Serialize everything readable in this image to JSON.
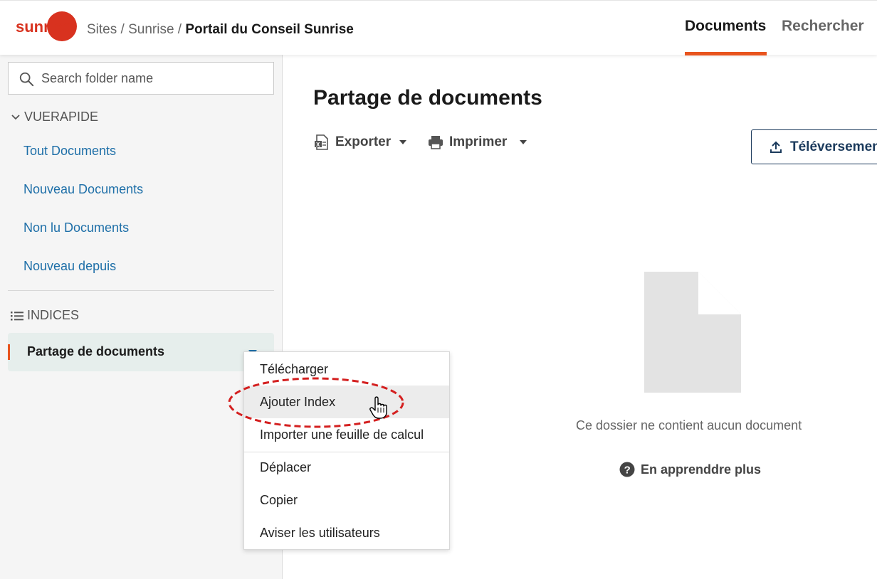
{
  "header": {
    "logo_text": "sunrise",
    "breadcrumb": {
      "items": [
        "Sites",
        "Sunrise"
      ],
      "separator": "/",
      "current": "Portail du Conseil Sunrise"
    },
    "tabs": [
      {
        "label": "Documents",
        "active": true
      },
      {
        "label": "Rechercher",
        "active": false
      }
    ]
  },
  "sidebar": {
    "search": {
      "placeholder": "Search folder name",
      "value": ""
    },
    "quick_view": {
      "title": "VUERAPIDE",
      "links": [
        "Tout Documents",
        "Nouveau Documents",
        "Non lu Documents",
        "Nouveau depuis"
      ]
    },
    "indices": {
      "title": "INDICES",
      "items": [
        {
          "label": "Partage de documents",
          "selected": true
        }
      ]
    }
  },
  "main": {
    "title": "Partage de documents",
    "toolbar": {
      "export_label": "Exporter",
      "print_label": "Imprimer",
      "upload_label": "Téléversement"
    },
    "empty_state": {
      "message": "Ce dossier ne contient aucun document",
      "learn_more": "En apprenddre plus"
    }
  },
  "context_menu": {
    "items": [
      {
        "label": "Télécharger"
      },
      {
        "label": "Ajouter Index",
        "hovered": true,
        "annotated": true
      },
      {
        "label": "Importer une feuille de calcul"
      },
      {
        "label": "Déplacer"
      },
      {
        "label": "Copier"
      },
      {
        "label": "Aviser les utilisateurs"
      }
    ]
  },
  "colors": {
    "brand": "#e8541e",
    "link": "#1e6fa8",
    "navy": "#1b3a5c",
    "annotation": "#d42020"
  },
  "icons": [
    "search-icon",
    "chevron-down-icon",
    "list-icon",
    "excel-icon",
    "printer-icon",
    "upload-icon",
    "document-icon",
    "help-icon",
    "hand-cursor-icon"
  ]
}
